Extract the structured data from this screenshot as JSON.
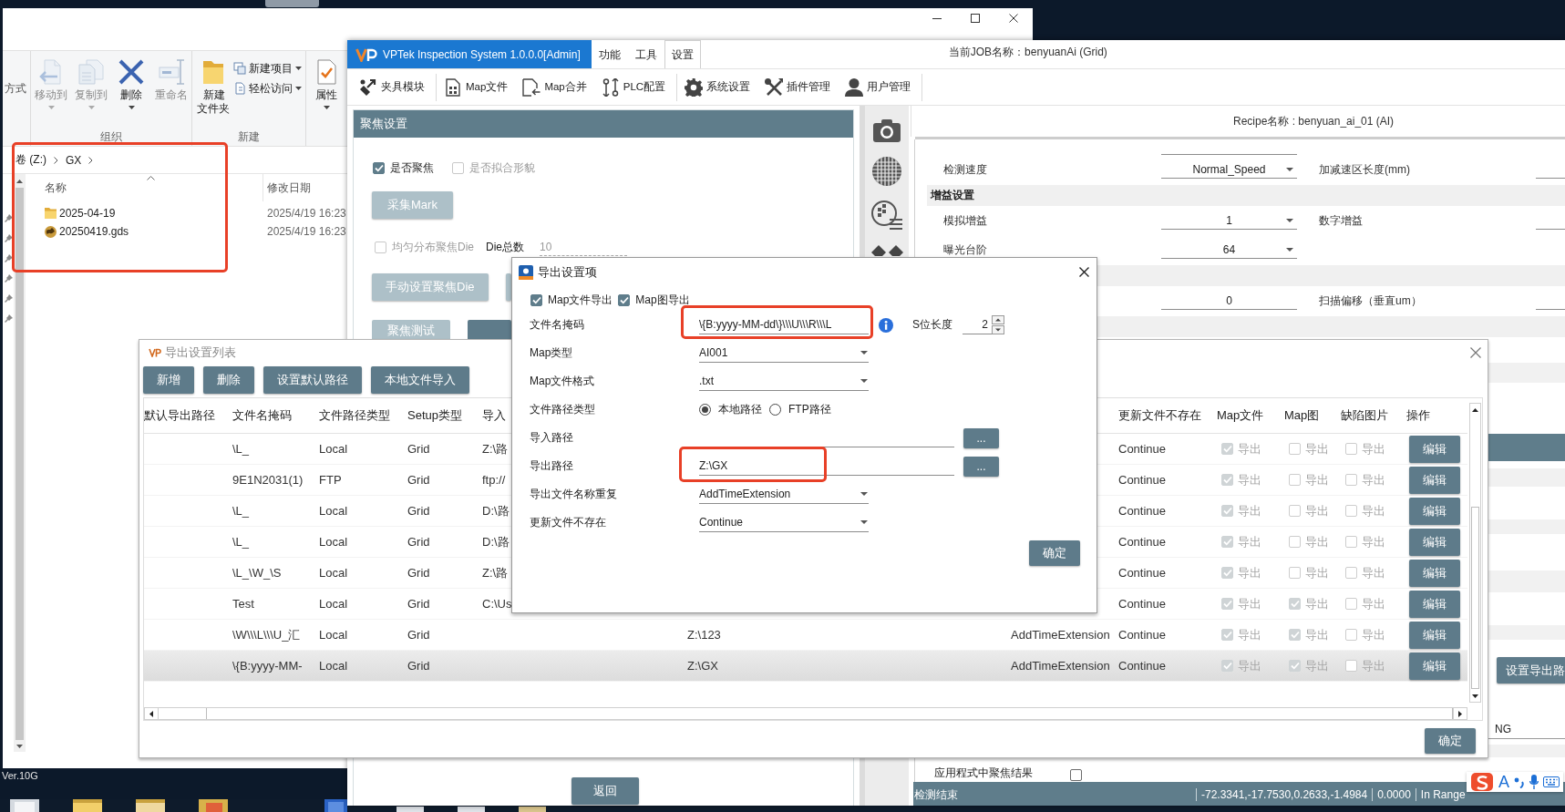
{
  "desktop": {
    "version": "Ver.10G"
  },
  "explorer": {
    "ribbon": {
      "cut_label": "方式",
      "groups": [
        {
          "label": "组织",
          "items": [
            {
              "kind": "large",
              "label": "移动到",
              "disabled": true,
              "dropdown": true
            },
            {
              "kind": "large",
              "label": "复制到",
              "disabled": true,
              "dropdown": true
            },
            {
              "kind": "large",
              "label": "删除",
              "disabled": false,
              "dropdown": true
            },
            {
              "kind": "large",
              "label": "重命名",
              "disabled": true,
              "dropdown": false
            }
          ]
        },
        {
          "label": "新建",
          "items": [
            {
              "kind": "large",
              "label": "新建文件夹",
              "disabled": false,
              "dropdown": false
            },
            {
              "kind": "small",
              "label": "新建项目",
              "disabled": false,
              "dropdown": true
            },
            {
              "kind": "small",
              "label": "轻松访问",
              "disabled": false,
              "dropdown": true
            }
          ]
        },
        {
          "items": [
            {
              "kind": "large",
              "label": "属性",
              "disabled": false,
              "dropdown": true
            }
          ]
        }
      ]
    },
    "address": [
      "卷 (Z:)",
      "GX"
    ],
    "columns": [
      "名称",
      "修改日期"
    ],
    "files": [
      {
        "kind": "folder",
        "name": "2025-04-19",
        "modified": "2025/4/19 16:23"
      },
      {
        "kind": "file",
        "name": "20250419.gds",
        "modified": "2025/4/19 16:23"
      }
    ],
    "highlighted": true
  },
  "app": {
    "title": "VPTek Inspection System 1.0.0.0[Admin]",
    "menu": [
      {
        "label": "功能",
        "selected": false
      },
      {
        "label": "工具",
        "selected": false
      },
      {
        "label": "设置",
        "selected": true
      }
    ],
    "job": "当前JOB名称：benyuanAi (Grid)",
    "toolbar": [
      {
        "items": [
          "夹具模块"
        ]
      },
      {
        "items": [
          "Map文件",
          "Map合并",
          "PLC配置"
        ]
      },
      {
        "items": [
          "系统设置",
          "插件管理",
          "用户管理"
        ]
      }
    ],
    "focus_panel": {
      "title": "聚焦设置",
      "rows": [
        {
          "controls": [
            {
              "kind": "checkbox",
              "label": "是否聚焦",
              "checked": true,
              "disabled": false
            },
            {
              "kind": "checkbox",
              "label": "是否拟合形貌",
              "checked": false,
              "disabled": true
            }
          ]
        },
        {
          "controls": [
            {
              "kind": "button",
              "label": "采集Mark",
              "disabled": true
            }
          ]
        },
        {
          "controls": [
            {
              "kind": "checkbox",
              "label": "均匀分布聚焦Die",
              "checked": false,
              "disabled": true
            },
            {
              "kind": "field",
              "label": "Die总数",
              "value": "10",
              "disabled": true
            }
          ]
        },
        {
          "controls": [
            {
              "kind": "button",
              "label": "手动设置聚焦Die",
              "disabled": true
            },
            {
              "kind": "button",
              "disabled": true
            }
          ]
        },
        {
          "controls": [
            {
              "kind": "button",
              "label": "聚焦测试",
              "disabled": true
            },
            {
              "kind": "button",
              "disabled": false
            }
          ]
        }
      ],
      "back": "返回"
    },
    "recipe": {
      "title": "Recipe名称 : benyuan_ai_01 (AI)",
      "rows": [
        {
          "kind": "partial"
        },
        {
          "kind": "row",
          "label": "检测速度",
          "value": "Normal_Speed",
          "dropdown": true,
          "label_2": "加减速区长度(mm)"
        },
        {
          "kind": "section",
          "title": "增益设置"
        },
        {
          "kind": "row",
          "label": "模拟增益",
          "value": "1",
          "dropdown": true,
          "label_2": "数字增益"
        },
        {
          "kind": "row",
          "label": "曝光台阶",
          "value": "64",
          "dropdown": true
        },
        {
          "kind": "section"
        },
        {
          "kind": "row",
          "value": "0",
          "dropdown": false,
          "label_2": "扫描偏移（垂直um）"
        },
        {
          "kind": "section"
        }
      ],
      "side_button": "设置导出路",
      "side_value": "NG",
      "option": {
        "label": "应用程式中聚焦结果",
        "checked": false
      }
    },
    "status": {
      "state": "检测结束",
      "readings": [
        "-72.3341,-17.7530,0.2633,-1.4984",
        "0.0000",
        "In Range"
      ]
    }
  },
  "export_list": {
    "title": "导出设置列表",
    "buttons": [
      "新增",
      "删除",
      "设置默认路径",
      "本地文件导入"
    ],
    "columns": [
      "默认导出路径",
      "文件名掩码",
      "文件路径类型",
      "Setup类型",
      "导入",
      "更新文件不存在",
      "Map文件",
      "Map图",
      "缺陷图片",
      "操作"
    ],
    "rows": [
      {
        "selected": false,
        "mask": "\\L_",
        "path_type": "Local",
        "setup_type": "Grid",
        "import_path": "Z:\\路",
        "update_missing": "Continue",
        "map_file": {
          "checked": true,
          "label": "导出"
        },
        "map_image": {
          "checked": false,
          "label": "导出"
        },
        "defect_image": {
          "checked": false,
          "label": "导出"
        },
        "action": "编辑"
      },
      {
        "selected": false,
        "mask": "9E1N2031(1)",
        "path_type": "FTP",
        "setup_type": "Grid",
        "import_path": "ftp://",
        "update_missing": "Continue",
        "map_file": {
          "checked": true,
          "label": "导出"
        },
        "map_image": {
          "checked": false,
          "label": "导出"
        },
        "defect_image": {
          "checked": false,
          "label": "导出"
        },
        "action": "编辑"
      },
      {
        "selected": false,
        "mask": "\\L_",
        "path_type": "Local",
        "setup_type": "Grid",
        "import_path": "D:\\路",
        "update_missing": "Continue",
        "map_file": {
          "checked": true,
          "label": "导出"
        },
        "map_image": {
          "checked": false,
          "label": "导出"
        },
        "defect_image": {
          "checked": false,
          "label": "导出"
        },
        "action": "编辑"
      },
      {
        "selected": false,
        "mask": "\\L_",
        "path_type": "Local",
        "setup_type": "Grid",
        "import_path": "D:\\路",
        "update_missing": "Continue",
        "map_file": {
          "checked": true,
          "label": "导出"
        },
        "map_image": {
          "checked": false,
          "label": "导出"
        },
        "defect_image": {
          "checked": false,
          "label": "导出"
        },
        "action": "编辑"
      },
      {
        "selected": false,
        "mask": "\\L_\\W_\\S",
        "path_type": "Local",
        "setup_type": "Grid",
        "import_path": "Z:\\路",
        "update_missing": "Continue",
        "map_file": {
          "checked": true,
          "label": "导出"
        },
        "map_image": {
          "checked": false,
          "label": "导出"
        },
        "defect_image": {
          "checked": false,
          "label": "导出"
        },
        "action": "编辑"
      },
      {
        "selected": false,
        "mask": "Test",
        "path_type": "Local",
        "setup_type": "Grid",
        "import_path": "C:\\Us",
        "update_missing": "Continue",
        "map_file": {
          "checked": true,
          "label": "导出"
        },
        "map_image": {
          "checked": true,
          "label": "导出"
        },
        "defect_image": {
          "checked": false,
          "label": "导出"
        },
        "action": "编辑"
      },
      {
        "selected": false,
        "mask": "\\W\\\\\\L\\\\\\U_汇",
        "path_type": "Local",
        "setup_type": "Grid",
        "column_6": "Z:\\123",
        "column_7": "AddTimeExtension",
        "update_missing": "Continue",
        "map_file": {
          "checked": true,
          "label": "导出"
        },
        "map_image": {
          "checked": true,
          "label": "导出"
        },
        "defect_image": {
          "checked": false,
          "label": "导出"
        },
        "action": "编辑"
      },
      {
        "selected": true,
        "mask": "\\{B:yyyy-MM-",
        "path_type": "Local",
        "setup_type": "Grid",
        "column_6": "Z:\\GX",
        "column_7": "AddTimeExtension",
        "update_missing": "Continue",
        "map_file": {
          "checked": true,
          "label": "导出"
        },
        "map_image": {
          "checked": true,
          "label": "导出"
        },
        "defect_image": {
          "checked": false,
          "label": "导出"
        },
        "action": "编辑"
      }
    ],
    "confirm": "确定"
  },
  "export_item": {
    "title": "导出设置项",
    "options": [
      {
        "label": "Map文件导出",
        "checked": true
      },
      {
        "label": "Map图导出",
        "checked": true
      }
    ],
    "fields": [
      {
        "kind": "text",
        "label": "文件名掩码",
        "value": "\\{B:yyyy-MM-dd\\}\\\\\\U\\\\\\R\\\\\\L",
        "highlighted": true
      },
      {
        "kind": "dropdown",
        "label": "Map类型",
        "value": "AI001",
        "highlighted": false
      },
      {
        "kind": "dropdown",
        "label": "Map文件格式",
        "value": ".txt",
        "highlighted": false
      },
      {
        "kind": "radio",
        "label": "文件路径类型",
        "options": [
          {
            "label": "本地路径",
            "selected": true
          },
          {
            "label": "FTP路径",
            "selected": false
          }
        ],
        "highlighted": false
      },
      {
        "kind": "path",
        "label": "导入路径",
        "button": "...",
        "highlighted": false
      },
      {
        "kind": "path",
        "label": "导出路径",
        "value": "Z:\\GX",
        "button": "...",
        "highlighted": true
      },
      {
        "kind": "dropdown",
        "label": "导出文件名称重复",
        "value": "AddTimeExtension",
        "highlighted": false
      },
      {
        "kind": "dropdown",
        "label": "更新文件不存在",
        "value": "Continue",
        "highlighted": false
      }
    ],
    "spinner": {
      "label": "S位长度",
      "value": "2"
    },
    "confirm": "确定"
  },
  "ime": {
    "mode": "A"
  }
}
